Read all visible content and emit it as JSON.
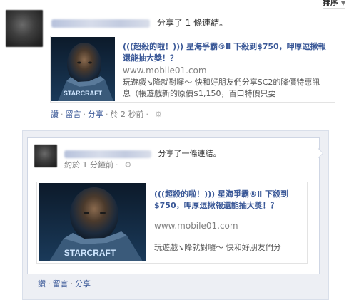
{
  "sort_label": "排序",
  "story1": {
    "action_text": "分享了 1 條連結。",
    "link": {
      "title": "(((超殺的啦！))) 星海爭霸®Ⅱ 下殺到$750，呷厚逗揪報還能抽大獎！？",
      "domain": "www.mobile01.com",
      "description": "玩遊戲↘降就對囉～ 快和好朋友們分享SC2的降價特惠訊息（帳遊戲新的原價$1,150，百口特價只要"
    },
    "actions": {
      "like": "讚",
      "comment": "留言",
      "share": "分享",
      "time": "於 2 秒前"
    }
  },
  "story2": {
    "action_text": "分享了一條連結。",
    "time": "約於 1 分鐘前",
    "link": {
      "title": "(((超殺的啦！))) 星海爭霸®Ⅱ 下殺到$750，呷厚逗揪報還能抽大獎！？",
      "domain": "www.mobile01.com",
      "description": "玩遊戲↘降就對囉～ 快和好朋友們分"
    },
    "actions": {
      "like": "讚",
      "comment": "留言",
      "share": "分享"
    }
  },
  "colors": {
    "link_blue": "#3b5998",
    "shared_box_bg": "#edeff4"
  },
  "icons": {
    "audience": "gear-icon",
    "starcraft_logo_text": "STARCRAFT"
  }
}
